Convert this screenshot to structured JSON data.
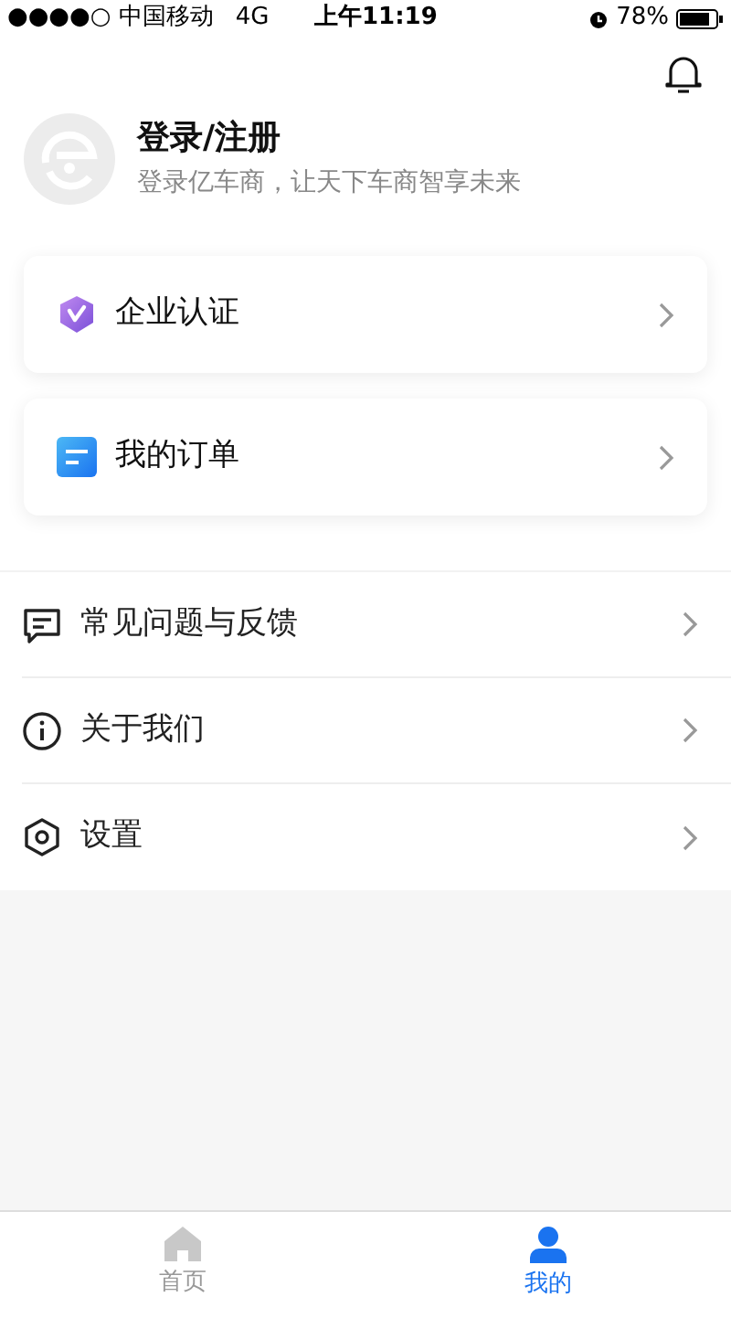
{
  "status_bar": {
    "carrier": "●●●●○ 中国移动",
    "network": "4G",
    "time": "上午11:19",
    "battery": "78%"
  },
  "profile": {
    "title": "登录/注册",
    "subtitle": "登录亿车商，让天下车商智享未来"
  },
  "cards": [
    {
      "kind": "verify",
      "label": "企业认证"
    },
    {
      "kind": "orders",
      "label": "我的订单"
    }
  ],
  "menu": [
    {
      "kind": "feedback",
      "label": "常见问题与反馈"
    },
    {
      "kind": "about",
      "label": "关于我们"
    },
    {
      "kind": "settings",
      "label": "设置"
    }
  ],
  "tabs": [
    {
      "kind": "home",
      "label": "首页",
      "selected": false
    },
    {
      "kind": "me",
      "label": "我的",
      "selected": true
    }
  ]
}
